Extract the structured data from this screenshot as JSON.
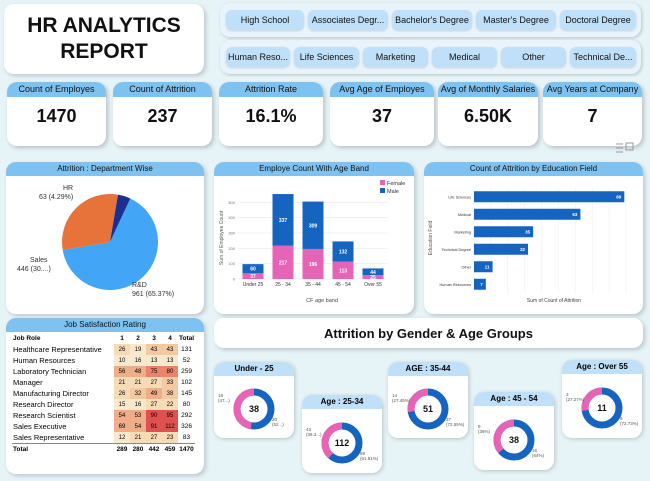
{
  "title": {
    "line1": "HR ANALYTICS",
    "line2": "REPORT"
  },
  "education_slicer": [
    "High School",
    "Associates Degr...",
    "Bachelor's Degree",
    "Master's Degree",
    "Doctoral Degree"
  ],
  "field_slicer": [
    "Human Reso...",
    "Life Sciences",
    "Marketing",
    "Medical",
    "Other",
    "Technical De..."
  ],
  "kpis": [
    {
      "label": "Count of Employes",
      "value": "1470"
    },
    {
      "label": "Count of Attrition",
      "value": "237"
    },
    {
      "label": "Attrition Rate",
      "value": "16.1%"
    },
    {
      "label": "Avg Age of Employes",
      "value": "37"
    },
    {
      "label": "Avg of Monthly Salaries",
      "value": "6.50K"
    },
    {
      "label": "Avg Years at Company",
      "value": "7"
    }
  ],
  "pie": {
    "title": "Attrition : Department Wise",
    "labels": {
      "hr1": "HR",
      "hr2": "63 (4.29%)",
      "sales1": "Sales",
      "sales2": "446 (30....)",
      "rd1": "R&D",
      "rd2": "961 (65.37%)"
    }
  },
  "age_band": {
    "title": "Employe Count With Age Band",
    "ylabel": "Sum of Employee Count",
    "xlabel": "CF age band",
    "legend_female": "Female",
    "legend_male": "Male",
    "yticks": [
      "0",
      "100",
      "200",
      "300",
      "400",
      "500"
    ]
  },
  "edu_field": {
    "title": "Count of Attrition by Education Field",
    "ylabel": "Education Field",
    "xlabel": "Sum of Count of Attrition"
  },
  "job_sat": {
    "title": "Job Satisfaction Rating",
    "headers": [
      "Job Role",
      "1",
      "2",
      "3",
      "4",
      "Total"
    ],
    "rows": [
      [
        "Healthcare Representative",
        "26",
        "19",
        "43",
        "43",
        "131"
      ],
      [
        "Human Resources",
        "10",
        "16",
        "13",
        "13",
        "52"
      ],
      [
        "Laboratory Technician",
        "56",
        "48",
        "75",
        "80",
        "259"
      ],
      [
        "Manager",
        "21",
        "21",
        "27",
        "33",
        "102"
      ],
      [
        "Manufacturing Director",
        "26",
        "32",
        "49",
        "38",
        "145"
      ],
      [
        "Research Director",
        "15",
        "16",
        "27",
        "22",
        "80"
      ],
      [
        "Research Scientist",
        "54",
        "53",
        "90",
        "95",
        "292"
      ],
      [
        "Sales Executive",
        "69",
        "54",
        "91",
        "112",
        "326"
      ],
      [
        "Sales Representative",
        "12",
        "21",
        "27",
        "23",
        "83"
      ],
      [
        "Total",
        "289",
        "280",
        "442",
        "459",
        "1470"
      ]
    ]
  },
  "gender_title": "Attrition by Gender & Age Groups",
  "groups": [
    {
      "name": "Under - 25",
      "center": "38",
      "lab_a1": "18",
      "lab_a2": "(47...)",
      "lab_b1": "20",
      "lab_b2": "(52...)"
    },
    {
      "name": "Age : 25-34",
      "center": "112",
      "lab_a1": "43",
      "lab_a2": "(38.3...)",
      "lab_b1": "69",
      "lab_b2": "(61.61%)"
    },
    {
      "name": "AGE : 35-44",
      "center": "51",
      "lab_a1": "14",
      "lab_a2": "(27.45%)",
      "lab_b1": "37",
      "lab_b2": "(72.55%)"
    },
    {
      "name": "Age : 45 - 54",
      "center": "38",
      "lab_a1": "9",
      "lab_a2": "(36%)",
      "lab_b1": "16",
      "lab_b2": "(64%)"
    },
    {
      "name": "Age : Over 55",
      "center": "11",
      "lab_a1": "3",
      "lab_a2": "(27.27%)",
      "lab_b1": "8",
      "lab_b2": "(72.73%)"
    }
  ],
  "colors": {
    "accent": "#7ec2f2",
    "female": "#e763b5",
    "male": "#1565c0",
    "sales": "#e8733a",
    "rd": "#42a5f5",
    "hr": "#1a2f8f"
  },
  "chart_data": [
    {
      "type": "pie",
      "title": "Attrition : Department Wise",
      "categories": [
        "R&D",
        "Sales",
        "HR"
      ],
      "values": [
        961,
        446,
        63
      ],
      "percent": [
        65.37,
        30.34,
        4.29
      ]
    },
    {
      "type": "bar",
      "title": "Employe Count With Age Band",
      "categories": [
        "Under 25",
        "25 - 34",
        "35 - 44",
        "45 - 54",
        "Over 55"
      ],
      "xlabel": "CF age band",
      "ylabel": "Sum of Employee Count",
      "series": [
        {
          "name": "Female",
          "values": [
            37,
            217,
            196,
            113,
            25
          ]
        },
        {
          "name": "Male",
          "values": [
            60,
            337,
            309,
            132,
            44
          ]
        }
      ],
      "ylim": [
        0,
        600
      ],
      "legend": "top-right"
    },
    {
      "type": "bar",
      "orientation": "horizontal",
      "title": "Count of Attrition by Education Field",
      "categories": [
        "Life Sciences",
        "Medical",
        "Marketing",
        "Technical Degree",
        "Other",
        "Human Resources"
      ],
      "values": [
        89,
        63,
        35,
        32,
        11,
        7
      ],
      "xlabel": "Sum of Count of Attrition",
      "ylabel": "Education Field"
    }
  ]
}
